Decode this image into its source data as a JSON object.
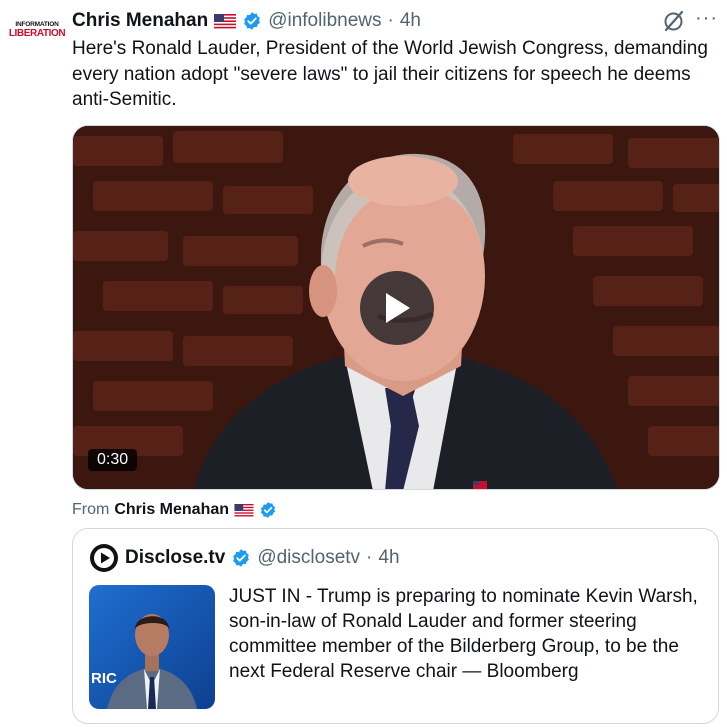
{
  "post": {
    "avatar": {
      "line1": "INFORMATION",
      "line2": "LIBERATION"
    },
    "author_name": "Chris Menahan",
    "handle": "@infolibnews",
    "separator": "·",
    "time": "4h",
    "text": "Here's Ronald Lauder, President of the World Jewish Congress, demanding every nation adopt \"severe laws\" to jail their citizens for speech he deems anti-Semitic.",
    "more_label": "···",
    "icons": [
      "flag-us-icon",
      "verified-badge-icon",
      "grok-icon",
      "more-icon",
      "play-icon"
    ]
  },
  "video": {
    "duration": "0:30"
  },
  "attribution": {
    "prefix": "From",
    "name": "Chris Menahan"
  },
  "quote": {
    "author_name": "Disclose.tv",
    "handle": "@disclosetv",
    "separator": "·",
    "time": "4h",
    "text": "JUST IN - Trump is preparing to nominate Kevin Warsh, son-in-law of Ronald Lauder and former steering committee member of the Bilderberg Group, to be the next Federal Reserve chair — Bloomberg",
    "thumb_caption": "RIC"
  },
  "colors": {
    "text_primary": "#0f1419",
    "text_secondary": "#536471",
    "verified_blue": "#1d9bf0",
    "border": "#cfd9de",
    "logo_red": "#c8102e"
  }
}
